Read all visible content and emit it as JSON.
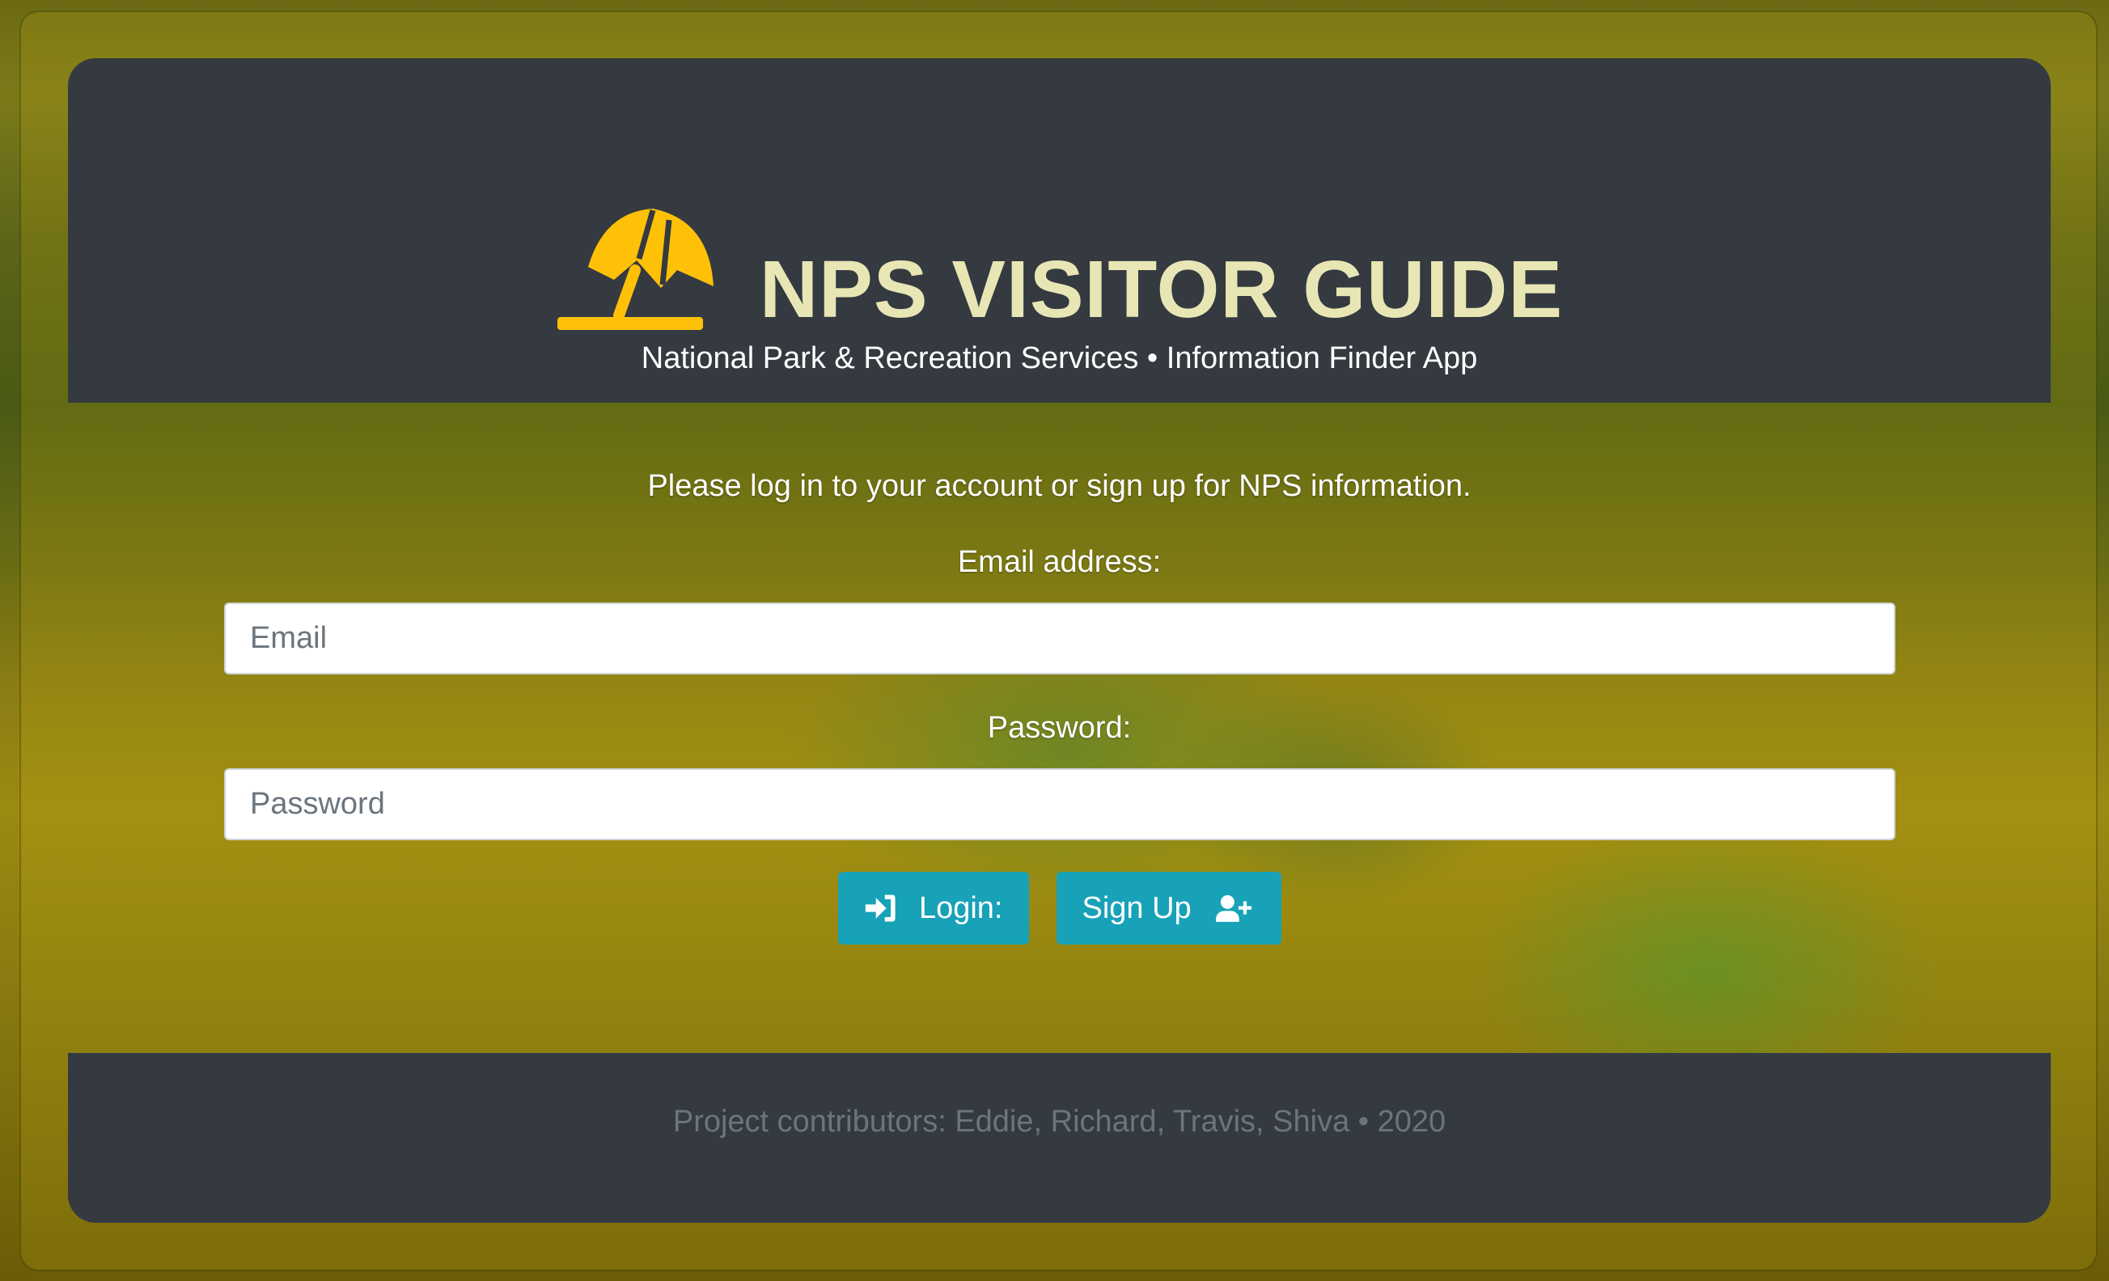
{
  "header": {
    "title": "NPS VISITOR GUIDE",
    "subtitle": "National Park & Recreation Services • Information Finder App",
    "logo_icon": "beach-umbrella-icon",
    "logo_color": "#ffc107"
  },
  "form": {
    "intro": "Please log in to your account or sign up for NPS information.",
    "email_label": "Email address:",
    "email_placeholder": "Email",
    "email_value": "",
    "password_label": "Password:",
    "password_placeholder": "Password",
    "password_value": "",
    "login_label": "Login:",
    "login_icon": "sign-in-icon",
    "signup_label": "Sign Up",
    "signup_icon": "user-plus-icon",
    "button_color": "#17a2b8"
  },
  "footer": {
    "text": "Project contributors: Eddie, Richard, Travis, Shiva • 2020"
  },
  "colors": {
    "panel": "#343a40",
    "title": "#e8e6b4",
    "footer_text": "#6c757d"
  }
}
